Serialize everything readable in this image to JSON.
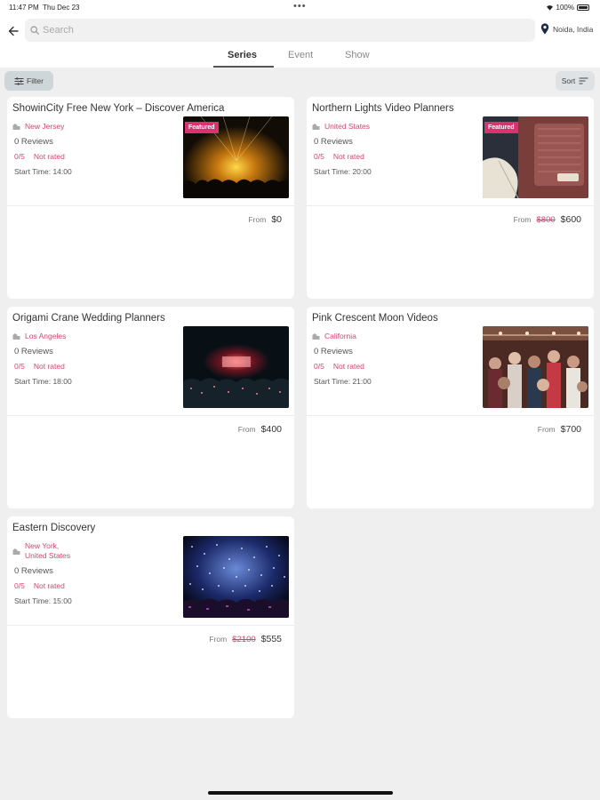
{
  "status_bar": {
    "time": "11:47 PM",
    "date": "Thu Dec 23",
    "battery": "100%"
  },
  "search": {
    "placeholder": "Search"
  },
  "location": {
    "label": "Noida, India"
  },
  "tabs": [
    {
      "label": "Series",
      "active": true
    },
    {
      "label": "Event",
      "active": false
    },
    {
      "label": "Show",
      "active": false
    }
  ],
  "toolbar": {
    "filter_label": "Filter",
    "sort_label": "Sort"
  },
  "listings": [
    {
      "title": "ShowinCity Free New York – Discover America",
      "location": "New Jersey",
      "reviews": "0 Reviews",
      "rating": "0/5",
      "rating_label": "Not rated",
      "start_time": "Start Time: 14:00",
      "featured": "Featured",
      "price_from": "From",
      "price_old": "",
      "price": "$0",
      "image": "concert-stage-yellow-lights"
    },
    {
      "title": "Northern Lights Video Planners",
      "location": "United States",
      "reviews": "0 Reviews",
      "rating": "0/5",
      "rating_label": "Not rated",
      "start_time": "Start Time: 20:00",
      "featured": "Featured",
      "price_from": "From",
      "price_old": "$800",
      "price": "$600",
      "image": "guitar-amplifier"
    },
    {
      "title": "Origami Crane Wedding Planners",
      "location": "Los Angeles",
      "reviews": "0 Reviews",
      "rating": "0/5",
      "rating_label": "Not rated",
      "start_time": "Start Time: 18:00",
      "featured": "",
      "price_from": "From",
      "price_old": "",
      "price": "$400",
      "image": "concert-crowd-red-stage"
    },
    {
      "title": "Pink Crescent Moon Videos",
      "location": "California",
      "reviews": "0 Reviews",
      "rating": "0/5",
      "rating_label": "Not rated",
      "start_time": "Start Time: 21:00",
      "featured": "",
      "price_from": "From",
      "price_old": "",
      "price": "$700",
      "image": "party-crowd"
    },
    {
      "title": "Eastern Discovery",
      "location": "New York,\nUnited States",
      "reviews": "0 Reviews",
      "rating": "0/5",
      "rating_label": "Not rated",
      "start_time": "Start Time: 15:00",
      "featured": "",
      "price_from": "From",
      "price_old": "$2100",
      "price": "$555",
      "image": "confetti-concert"
    }
  ],
  "colors": {
    "accent": "#d6466e",
    "featured_badge": "#d8336e",
    "background": "#efefef",
    "card": "#ffffff"
  }
}
